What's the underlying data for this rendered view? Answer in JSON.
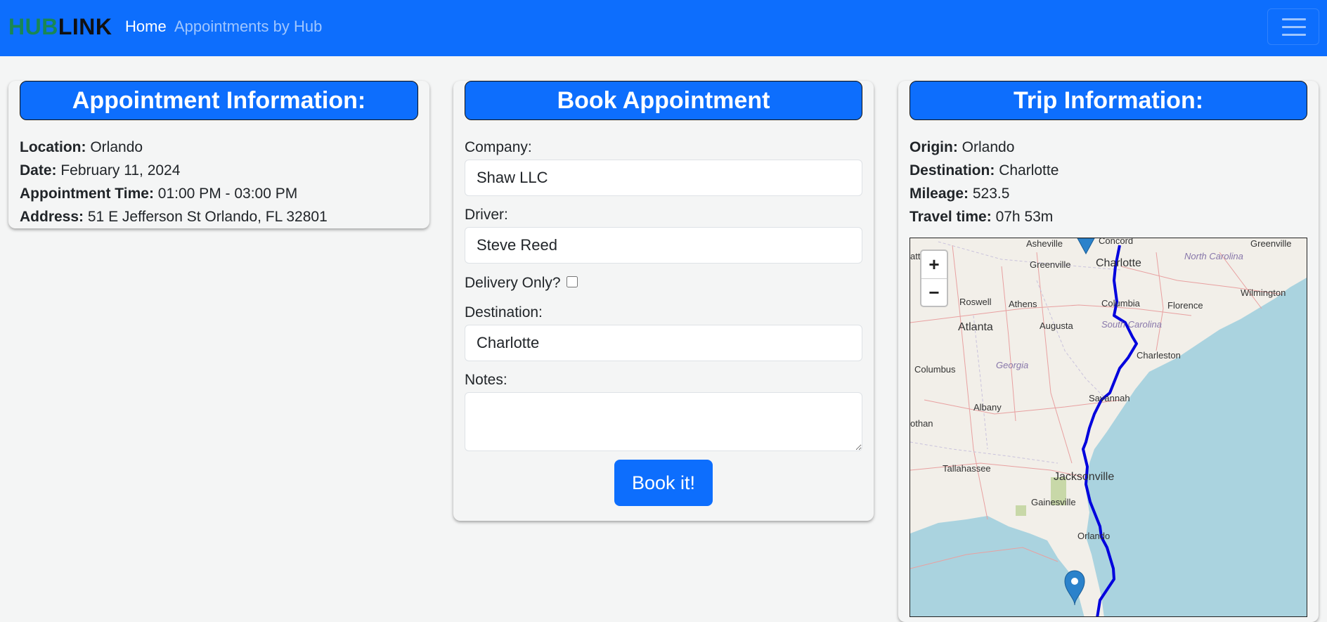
{
  "navbar": {
    "brand_hub": "HUB",
    "brand_link": "LINK",
    "home": "Home",
    "appointments_by_hub": "Appointments by Hub"
  },
  "appointment_info": {
    "title": "Appointment Information:",
    "location_label": "Location:",
    "location": "Orlando",
    "date_label": "Date:",
    "date": "February 11, 2024",
    "time_label": "Appointment Time:",
    "time": "01:00 PM - 03:00 PM",
    "address_label": "Address:",
    "address": "51 E Jefferson St Orlando, FL 32801"
  },
  "book": {
    "title": "Book Appointment",
    "company_label": "Company:",
    "company_value": "Shaw LLC",
    "driver_label": "Driver:",
    "driver_value": "Steve Reed",
    "delivery_only_label": "Delivery Only?",
    "delivery_only_checked": false,
    "destination_label": "Destination:",
    "destination_value": "Charlotte",
    "notes_label": "Notes:",
    "notes_value": "",
    "button": "Book it!"
  },
  "trip": {
    "title": "Trip Information:",
    "origin_label": "Origin:",
    "origin": "Orlando",
    "destination_label": "Destination:",
    "destination": "Charlotte",
    "mileage_label": "Mileage:",
    "mileage": "523.5",
    "travel_time_label": "Travel time:",
    "travel_time": "07h 53m"
  },
  "map": {
    "zoom_in": "+",
    "zoom_out": "−",
    "labels": {
      "asheville": "Asheville",
      "concord": "Concord",
      "greenville_nc": "Greenville",
      "greenville_sc": "Greenville",
      "charlotte": "Charlotte",
      "north_carolina": "North Carolina",
      "roswell": "Roswell",
      "athens": "Athens",
      "columbia": "Columbia",
      "florence": "Florence",
      "wilmington": "Wilmington",
      "atlanta": "Atlanta",
      "augusta": "Augusta",
      "south_carolina": "South Carolina",
      "charleston": "Charleston",
      "columbus": "Columbus",
      "georgia": "Georgia",
      "savannah": "Savannah",
      "albany": "Albany",
      "dothan": "othan",
      "tallahassee": "Tallahassee",
      "jacksonville": "Jacksonville",
      "gainesville": "Gainesville",
      "orlando": "Orlando",
      "atta": "atta"
    },
    "colors": {
      "route": "#0000dd",
      "marker": "#2b82cb",
      "ocean": "#aad3df",
      "land": "#f2efe9"
    }
  }
}
